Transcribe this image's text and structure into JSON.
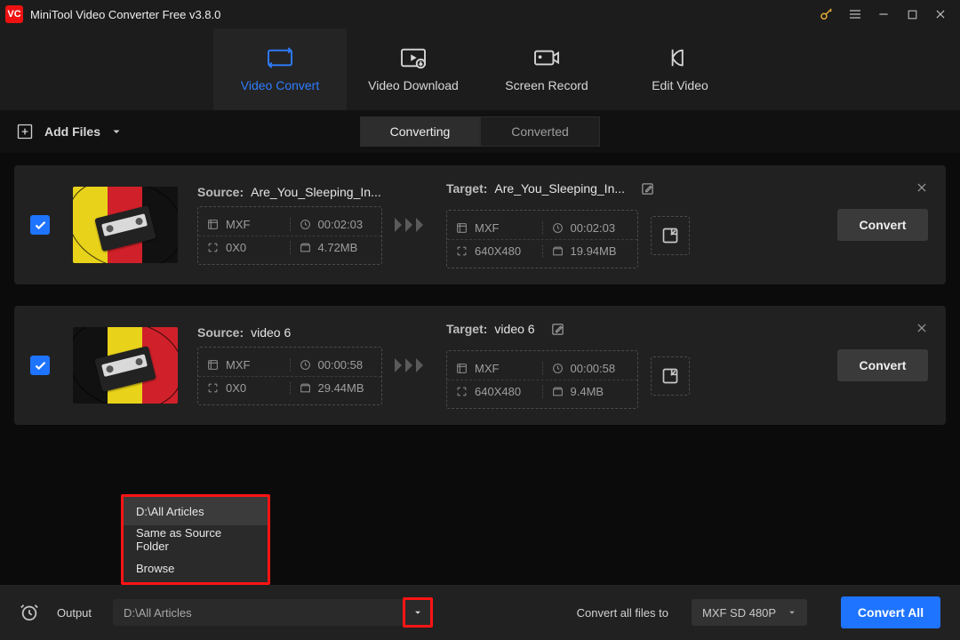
{
  "app": {
    "title": "MiniTool Video Converter Free v3.8.0",
    "logo_text": "VC"
  },
  "tabs": {
    "video_convert": "Video Convert",
    "video_download": "Video Download",
    "screen_record": "Screen Record",
    "edit_video": "Edit Video"
  },
  "toolbar": {
    "add_files": "Add Files",
    "converting": "Converting",
    "converted": "Converted"
  },
  "labels": {
    "source": "Source:",
    "target": "Target:",
    "convert": "Convert"
  },
  "items": [
    {
      "source_name": "Are_You_Sleeping_In...",
      "target_name": "Are_You_Sleeping_In...",
      "src": {
        "fmt": "MXF",
        "dur": "00:02:03",
        "res": "0X0",
        "size": "4.72MB"
      },
      "tgt": {
        "fmt": "MXF",
        "dur": "00:02:03",
        "res": "640X480",
        "size": "19.94MB"
      }
    },
    {
      "source_name": "video 6",
      "target_name": "video 6",
      "src": {
        "fmt": "MXF",
        "dur": "00:00:58",
        "res": "0X0",
        "size": "29.44MB"
      },
      "tgt": {
        "fmt": "MXF",
        "dur": "00:00:58",
        "res": "640X480",
        "size": "9.4MB"
      }
    }
  ],
  "output_menu": {
    "opt_recent": "D:\\All Articles",
    "opt_same": "Same as Source Folder",
    "opt_browse": "Browse"
  },
  "bottom": {
    "output_label": "Output",
    "output_path": "D:\\All Articles",
    "convert_all_to": "Convert all files to",
    "format": "MXF SD 480P",
    "convert_all": "Convert All"
  }
}
